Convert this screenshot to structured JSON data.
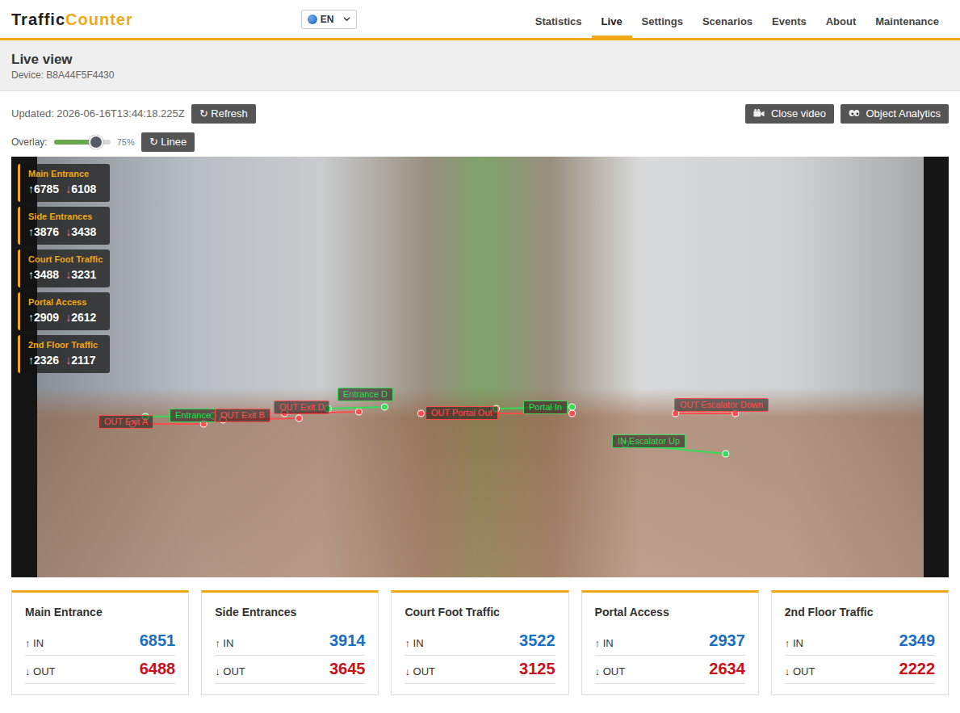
{
  "brand": {
    "first": "Traffic",
    "second": "Counter"
  },
  "language": {
    "value": "EN"
  },
  "nav": [
    {
      "label": "Statistics",
      "selected": false
    },
    {
      "label": "Live",
      "selected": true
    },
    {
      "label": "Settings",
      "selected": false
    },
    {
      "label": "Scenarios",
      "selected": false
    },
    {
      "label": "Events",
      "selected": false
    },
    {
      "label": "About",
      "selected": false
    },
    {
      "label": "Maintenance",
      "selected": false
    }
  ],
  "header": {
    "title": "Live view",
    "device": "Device: B8A44F5F4430"
  },
  "toolbar": {
    "updated": "Updated: 2026-06-16T13:44:18.225Z",
    "refresh": {
      "icon": "↻",
      "label": "Refresh"
    },
    "close_video": "Close video",
    "object_analytics": "Object Analytics"
  },
  "overlay": {
    "label": "Overlay:",
    "level": 0.75,
    "reading": "75%",
    "lines_button": {
      "icon": "↻",
      "label": "Linee"
    }
  },
  "video": {
    "counters": [
      {
        "title": "Main Entrance",
        "in_arrow": "↑",
        "in": "6785",
        "out_arrow": "↓",
        "out": "6108"
      },
      {
        "title": "Side Entrances",
        "in_arrow": "↑",
        "in": "3876",
        "out_arrow": "↓",
        "out": "3438"
      },
      {
        "title": "Court Foot Traffic",
        "in_arrow": "↑",
        "in": "3488",
        "out_arrow": "↓",
        "out": "3231"
      },
      {
        "title": "Portal Access",
        "in_arrow": "↑",
        "in": "2909",
        "out_arrow": "↓",
        "out": "2612"
      },
      {
        "title": "2nd Floor Traffic",
        "in_arrow": "↑",
        "in": "2326",
        "out_arrow": "↓",
        "out": "2117"
      }
    ],
    "lines": [
      {
        "label": "OUT Exit A",
        "color": "#ff4d4d"
      },
      {
        "label": "Entrance",
        "color": "#33dd55"
      },
      {
        "label": "OUT Exit B",
        "color": "#ff4d4d"
      },
      {
        "label": "OUT Exit D",
        "color": "#ff4d4d"
      },
      {
        "label": "Entrance D",
        "color": "#33dd55"
      },
      {
        "label": "OUT Portal Out",
        "color": "#ff4d4d"
      },
      {
        "label": "Portal In",
        "color": "#33dd55"
      },
      {
        "label": "OUT Escalator Down",
        "color": "#ff4d4d"
      },
      {
        "label": "IN Escalator Up",
        "color": "#33dd55"
      }
    ]
  },
  "cards": [
    {
      "title": "Main Entrance",
      "in_label": "↑ IN",
      "in": "6851",
      "out_label": "↓ OUT",
      "out": "6488"
    },
    {
      "title": "Side Entrances",
      "in_label": "↑ IN",
      "in": "3914",
      "out_label": "↓ OUT",
      "out": "3645"
    },
    {
      "title": "Court Foot Traffic",
      "in_label": "↑ IN",
      "in": "3522",
      "out_label": "↓ OUT",
      "out": "3125"
    },
    {
      "title": "Portal Access",
      "in_label": "↑ IN",
      "in": "2937",
      "out_label": "↓ OUT",
      "out": "2634"
    },
    {
      "title": "2nd Floor Traffic",
      "in_label": "↑ IN",
      "in": "2349",
      "out_label": "↓ OUT",
      "out": "2222"
    }
  ]
}
